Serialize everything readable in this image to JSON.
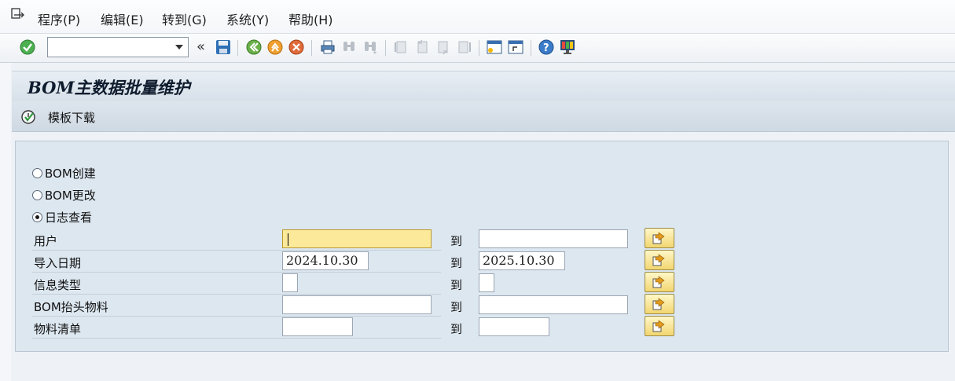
{
  "menu": {
    "items": [
      {
        "label": "程序(P)"
      },
      {
        "label": "编辑(E)"
      },
      {
        "label": "转到(G)"
      },
      {
        "label": "系统(Y)"
      },
      {
        "label": "帮助(H)"
      }
    ]
  },
  "toolbar": {
    "command_field_value": "",
    "icons": [
      "enter-icon",
      "command-dropdown-icon",
      "collapse-icon",
      "save-icon",
      "back-icon",
      "exit-icon",
      "cancel-icon",
      "print-icon",
      "find-icon",
      "find-next-icon",
      "first-page-icon",
      "previous-page-icon",
      "next-page-icon",
      "last-page-icon",
      "create-session-icon",
      "shortcut-icon",
      "help-icon",
      "customize-layout-icon"
    ]
  },
  "title": "BOM主数据批量维护",
  "app_toolbar": {
    "template_download_label": "模板下载"
  },
  "options": [
    {
      "label": "BOM创建",
      "selected": false
    },
    {
      "label": "BOM更改",
      "selected": false
    },
    {
      "label": "日志查看",
      "selected": true
    }
  ],
  "fields": [
    {
      "label": "用户",
      "from": "",
      "to_label": "到",
      "to": ""
    },
    {
      "label": "导入日期",
      "from": "2024.10.30",
      "to_label": "到",
      "to": "2025.10.30"
    },
    {
      "label": "信息类型",
      "from": "",
      "to_label": "到",
      "to": ""
    },
    {
      "label": "BOM抬头物料",
      "from": "",
      "to_label": "到",
      "to": ""
    },
    {
      "label": "物料清单",
      "from": "",
      "to_label": "到",
      "to": ""
    }
  ],
  "colors": {
    "focused_input": "#fde99a",
    "panel_bg": "#dde7f0",
    "multi_button": "#f2d670"
  }
}
